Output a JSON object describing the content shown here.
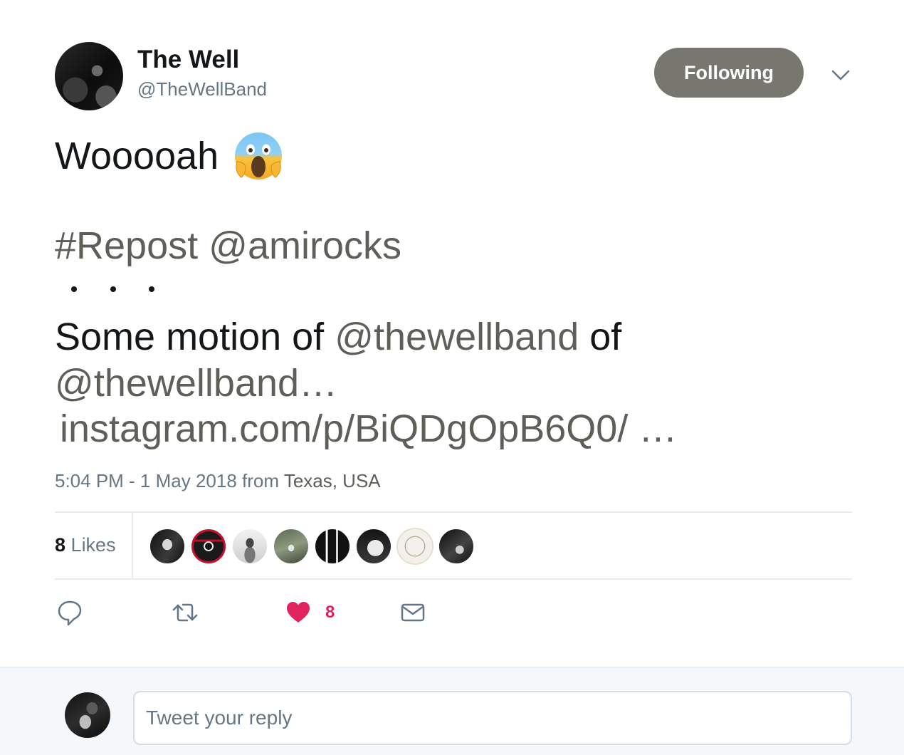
{
  "author": {
    "name": "The Well",
    "handle": "@TheWellBand"
  },
  "header": {
    "follow_label": "Following"
  },
  "tweet": {
    "line1": "Wooooah",
    "emoji": "face-screaming-in-fear",
    "hashtag": "#Repost",
    "repost_mention": "@amirocks",
    "line3_prefix": "Some motion of",
    "mention_a": "@thewellband",
    "line3_suffix": "of",
    "mention_b": "@thewellband…",
    "link": "instagram.com/p/BiQDgOpB6Q0/ …"
  },
  "meta": {
    "time": "5:04 PM - 1 May 2018",
    "from": "from",
    "location": "Texas, USA"
  },
  "stats": {
    "likes_count": "8",
    "likes_label": "Likes",
    "likers_shown": 8
  },
  "actions": {
    "like_count": "8"
  },
  "reply": {
    "placeholder": "Tweet your reply"
  },
  "colors": {
    "follow_button": "#77776f",
    "link_text": "#5f5f59",
    "secondary_text": "#657786",
    "like": "#e0245e",
    "icon": "#657786"
  }
}
